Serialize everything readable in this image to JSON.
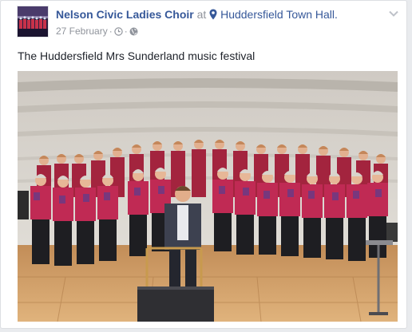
{
  "post": {
    "page_name": "Nelson Civic Ladies Choir",
    "at_word": "at",
    "location": "Huddersfield Town Hall.",
    "date": "27 February",
    "separator": "·",
    "text": "The Huddersfield Mrs Sunderland music festival"
  },
  "icons": {
    "location": "map-pin-icon",
    "edited": "clock-icon",
    "privacy": "globe-icon",
    "menu": "chevron-down-icon"
  },
  "colors": {
    "link": "#365899",
    "meta": "#90949c",
    "text": "#1d2129",
    "card_border": "#dddfe2",
    "page_bg": "#e9ebee"
  }
}
